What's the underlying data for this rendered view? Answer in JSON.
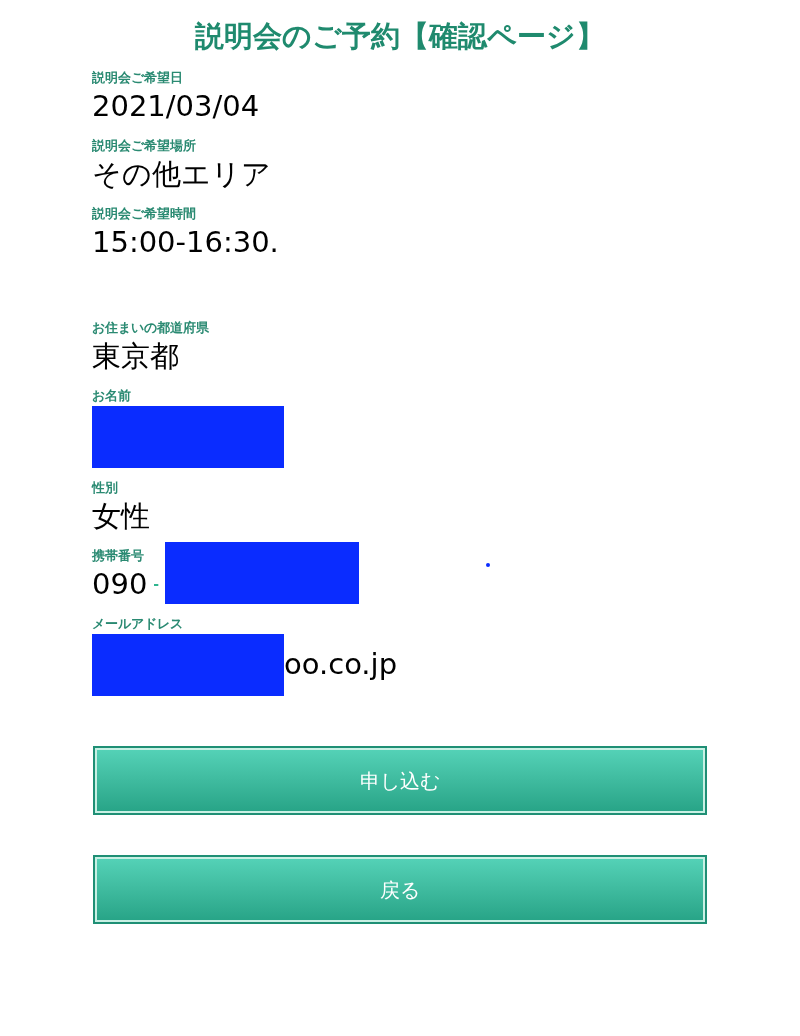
{
  "title": "説明会のご予約【確認ページ】",
  "sections": [
    [
      {
        "label": "説明会ご希望日",
        "parts": [
          {
            "kind": "text",
            "text": "2021/03/04"
          }
        ]
      },
      {
        "label": "説明会ご希望場所",
        "parts": [
          {
            "kind": "text",
            "text": "その他エリア"
          }
        ]
      },
      {
        "label": "説明会ご希望時間",
        "parts": [
          {
            "kind": "text",
            "text": "15:00-16:30."
          }
        ]
      }
    ],
    [
      {
        "label": "お住まいの都道府県",
        "parts": [
          {
            "kind": "text",
            "text": "東京都"
          }
        ]
      },
      {
        "label": "お名前",
        "parts": [
          {
            "kind": "redacted"
          }
        ]
      },
      {
        "label": "性別",
        "parts": [
          {
            "kind": "text",
            "text": "女性"
          }
        ]
      },
      {
        "label": "携帯番号",
        "parts": [
          {
            "kind": "text",
            "text": "090"
          },
          {
            "kind": "separator",
            "text": "-"
          },
          {
            "kind": "redacted"
          }
        ]
      },
      {
        "label": "メールアドレス",
        "parts": [
          {
            "kind": "redacted"
          },
          {
            "kind": "text",
            "text": "oo.co.jp"
          }
        ]
      }
    ]
  ],
  "buttons": [
    "申し込む",
    "戻る"
  ]
}
